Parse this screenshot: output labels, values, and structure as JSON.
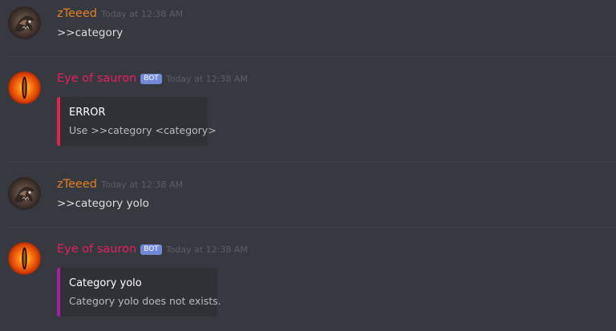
{
  "messages": [
    {
      "username": "zTeeed",
      "timestamp": "Today at 12:38 AM",
      "content": ">>category",
      "avatar_icon": "dragon-avatar"
    },
    {
      "username": "Eye of sauron",
      "bot_tag": "BOT",
      "timestamp": "Today at 12:38 AM",
      "avatar_icon": "eye-of-sauron-avatar",
      "embed": {
        "title": "ERROR",
        "description": "Use >>category <category>",
        "color": "#e3224e"
      }
    },
    {
      "username": "zTeeed",
      "timestamp": "Today at 12:38 AM",
      "content": ">>category yolo",
      "avatar_icon": "dragon-avatar"
    },
    {
      "username": "Eye of sauron",
      "bot_tag": "BOT",
      "timestamp": "Today at 12:38 AM",
      "avatar_icon": "eye-of-sauron-avatar",
      "embed": {
        "title": "Category yolo",
        "description": "Category yolo does not exists.",
        "color": "#a51fa0"
      }
    }
  ],
  "colors": {
    "background": "#36393f",
    "user_name_color": "#e67e22",
    "bot_name_color": "#e91e63",
    "bot_tag": "#7289da",
    "embed_background": "#2f3136"
  }
}
